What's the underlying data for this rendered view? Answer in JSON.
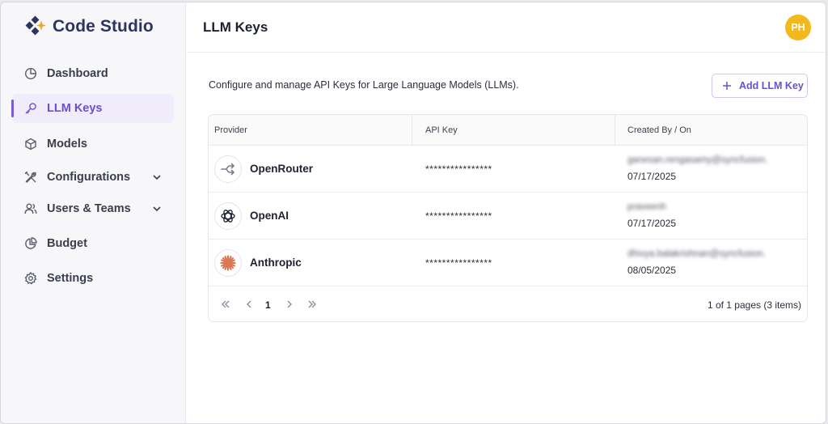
{
  "app": {
    "name": "Code Studio"
  },
  "sidebar": {
    "items": [
      {
        "label": "Dashboard",
        "icon": "dashboard-icon"
      },
      {
        "label": "LLM Keys",
        "icon": "key-icon",
        "active": true
      },
      {
        "label": "Models",
        "icon": "cube-icon"
      },
      {
        "label": "Configurations",
        "icon": "tools-icon",
        "expandable": true
      },
      {
        "label": "Users & Teams",
        "icon": "users-icon",
        "expandable": true
      },
      {
        "label": "Budget",
        "icon": "pie-chart-icon"
      },
      {
        "label": "Settings",
        "icon": "gear-icon"
      }
    ]
  },
  "header": {
    "title": "LLM Keys",
    "avatar_initials": "PH"
  },
  "main": {
    "description": "Configure and manage API Keys for Large Language Models (LLMs).",
    "add_button_label": "Add LLM Key"
  },
  "table": {
    "columns": [
      "Provider",
      "API Key",
      "Created By / On"
    ],
    "rows": [
      {
        "provider": "OpenRouter",
        "api_key": "****************",
        "created_by": "ganesan.rengasamy@syncfusion.",
        "created_on": "07/17/2025",
        "icon": "openrouter-icon"
      },
      {
        "provider": "OpenAI",
        "api_key": "****************",
        "created_by": "praveenh",
        "created_on": "07/17/2025",
        "icon": "openai-icon"
      },
      {
        "provider": "Anthropic",
        "api_key": "****************",
        "created_by": "dhivya.balakrishnan@syncfusion.",
        "created_on": "08/05/2025",
        "icon": "anthropic-icon"
      }
    ]
  },
  "pager": {
    "current_page": "1",
    "info": "1 of 1 pages (3 items)"
  },
  "colors": {
    "accent": "#6b4fd0",
    "avatar_bg": "#f2b81c",
    "brand": "#2f3361",
    "anthropic": "#d97757"
  }
}
